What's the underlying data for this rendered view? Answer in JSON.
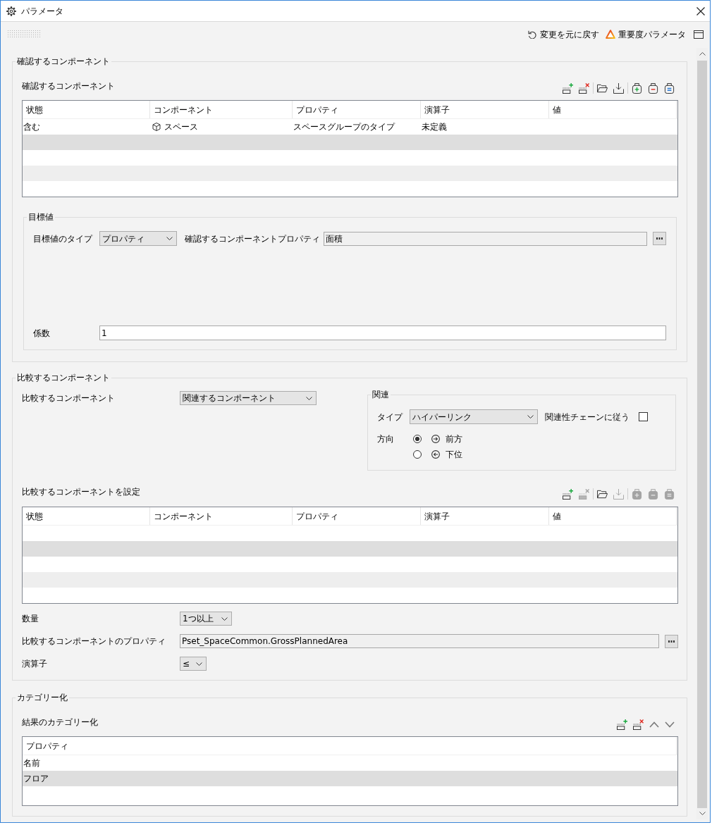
{
  "window": {
    "title": "パラメータ"
  },
  "header_actions": [
    {
      "kind": "undo",
      "label": "変更を元に戻す"
    },
    {
      "kind": "severity",
      "label": "重要度パラメータ"
    },
    {
      "kind": "panel"
    }
  ],
  "check_group": {
    "legend": "確認するコンポーネント",
    "label": "確認するコンポーネント",
    "tools": [
      [
        {
          "kind": "add_row",
          "disabled": false
        },
        {
          "kind": "remove_row",
          "disabled": false
        }
      ],
      [
        {
          "kind": "open",
          "disabled": false
        },
        {
          "kind": "save",
          "disabled": false
        }
      ],
      [
        {
          "kind": "bag_add",
          "disabled": false
        },
        {
          "kind": "bag_remove",
          "disabled": false
        },
        {
          "kind": "bag_equal",
          "disabled": false
        }
      ]
    ],
    "table": {
      "columns": [
        "状態",
        "コンポーネント",
        "プロパティ",
        "演算子",
        "値"
      ],
      "rows": [
        [
          "含む",
          "スペース",
          "スペースグループのタイプ",
          "未定義"
        ]
      ]
    },
    "target": {
      "legend": "目標値",
      "type_label": "目標値のタイプ",
      "type_value": "プロパティ",
      "property_label": "確認するコンポーネントプロパティ",
      "property_value": "面積",
      "property_read_only": true,
      "factor_label": "係数",
      "factor_value": "1",
      "factor_read_only": false
    }
  },
  "compare_group": {
    "legend": "比較するコンポーネント",
    "source_label": "比較するコンポーネント",
    "source_value": "関連するコンポーネント",
    "relation": {
      "legend": "関連",
      "type_label": "タイプ",
      "type_value": "ハイパーリンク",
      "chain_label": "関連性チェーンに従う",
      "chain_checked": false,
      "direction_label": "方向",
      "directions": [
        {
          "kind": "forward",
          "label": "前方",
          "selected": true
        },
        {
          "kind": "backward",
          "label": "下位",
          "selected": false
        }
      ]
    },
    "set_label": "比較するコンポーネントを設定",
    "tools": [
      [
        {
          "kind": "add_row",
          "disabled": false
        },
        {
          "kind": "remove_row",
          "disabled": true
        }
      ],
      [
        {
          "kind": "open",
          "disabled": false
        },
        {
          "kind": "save",
          "disabled": true
        }
      ],
      [
        {
          "kind": "bag_add",
          "disabled": true
        },
        {
          "kind": "bag_remove",
          "disabled": true
        },
        {
          "kind": "bag_equal",
          "disabled": true
        }
      ]
    ],
    "table": {
      "columns": [
        "状態",
        "コンポーネント",
        "プロパティ",
        "演算子",
        "値"
      ]
    },
    "quantity_label": "数量",
    "quantity_value": "1つ以上",
    "property_label": "比較するコンポーネントのプロパティ",
    "property_value": "Pset_SpaceCommon.GrossPlannedArea",
    "property_read_only": true,
    "operator_label": "演算子",
    "operator_value": "≤"
  },
  "categorize": {
    "legend": "カテゴリー化",
    "label": "結果のカテゴリー化",
    "tools": [
      [
        {
          "kind": "add_row",
          "disabled": false
        },
        {
          "kind": "remove_row",
          "disabled": false
        },
        {
          "kind": "move_up",
          "disabled": false
        },
        {
          "kind": "move_down",
          "disabled": false
        }
      ]
    ],
    "table": {
      "columns": [
        "プロパティ"
      ],
      "rows": [
        [
          "名前"
        ],
        [
          "フロア"
        ]
      ]
    }
  }
}
